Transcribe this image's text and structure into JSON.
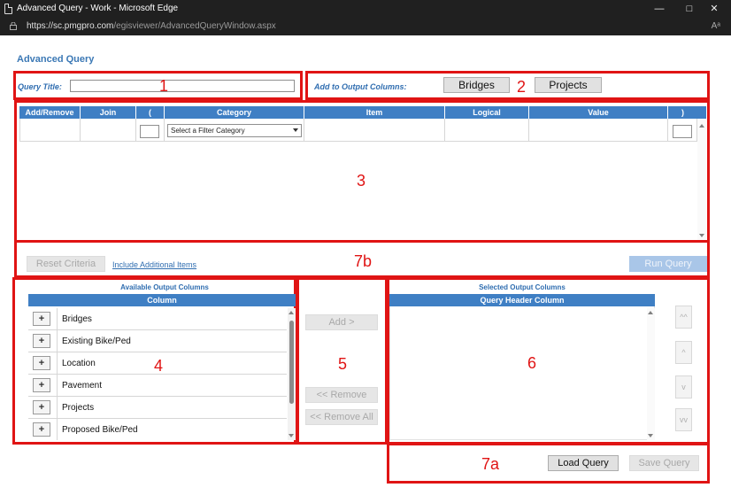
{
  "window": {
    "title": "Advanced Query - Work - Microsoft Edge",
    "url_domain": "https://sc.pmgpro.com",
    "url_path": "/egisviewer/AdvancedQueryWindow.aspx",
    "reader_icon": "Aᵃ"
  },
  "page": {
    "heading": "Advanced Query",
    "query_title_label": "Query Title:",
    "query_title_value": "",
    "add_to_output_label": "Add to Output Columns:",
    "bridges_button": "Bridges",
    "projects_button": "Projects"
  },
  "criteria": {
    "columns": [
      "Add/Remove",
      "Join",
      "(",
      "Category",
      "Item",
      "Logical",
      "Value",
      ")"
    ],
    "category_select": "Select a Filter Category",
    "reset_button": "Reset Criteria",
    "include_link": "Include Additional Items",
    "run_button": "Run Query"
  },
  "available": {
    "title": "Available Output Columns",
    "column_header": "Column",
    "plus_label": "+",
    "items": [
      "Bridges",
      "Existing Bike/Ped",
      "Location",
      "Pavement",
      "Projects",
      "Proposed Bike/Ped"
    ]
  },
  "transfer": {
    "add": "Add >",
    "remove": "<< Remove",
    "remove_all": "<< Remove All"
  },
  "selected": {
    "title": "Selected Output Columns",
    "column_header": "Query Header Column",
    "order_buttons": [
      "^^",
      "^",
      "v",
      "vv"
    ]
  },
  "footer": {
    "load_button": "Load Query",
    "save_button": "Save Query"
  },
  "annotations": {
    "labels": [
      "1",
      "2",
      "3",
      "4",
      "5",
      "6",
      "7a",
      "7b"
    ],
    "color": "#e01414"
  },
  "colors": {
    "header_blue": "#3f7fc4",
    "label_blue": "#2f6db0"
  }
}
